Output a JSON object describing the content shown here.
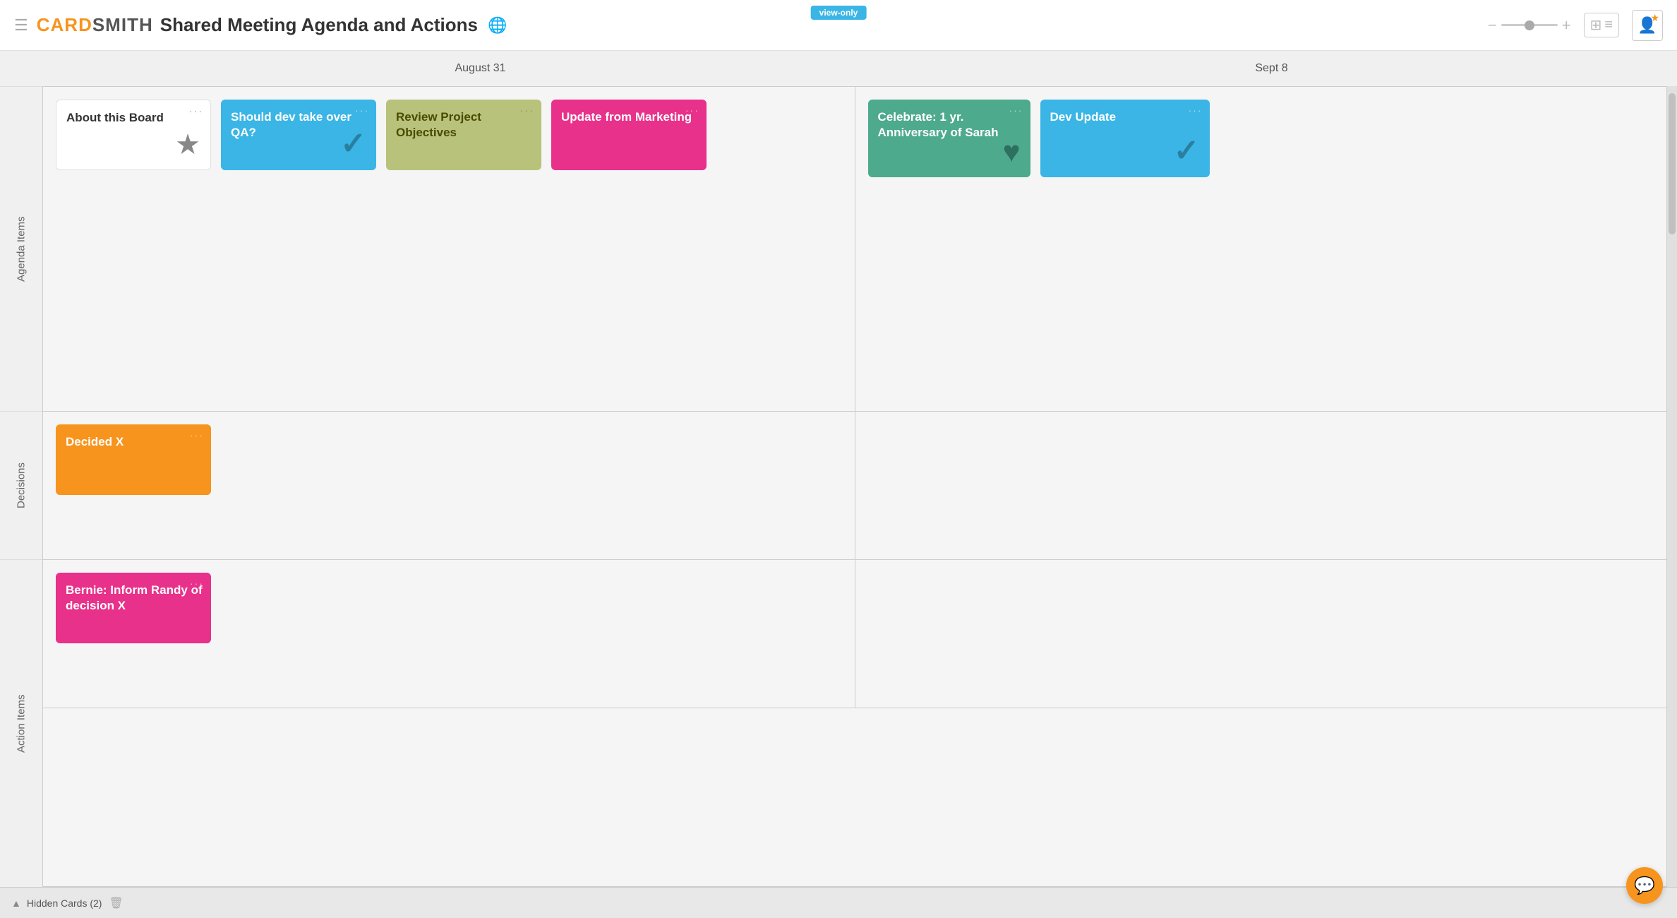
{
  "header": {
    "hamburger": "☰",
    "logo_card": "CARD",
    "logo_smith": "SMITH",
    "board_title": "Shared Meeting Agenda and Actions",
    "view_only_badge": "view-only",
    "zoom_minus": "−",
    "zoom_plus": "+",
    "globe_icon": "🌐",
    "grid_icon": "⊞",
    "list_icon": "≡",
    "profile_icon": "👤",
    "star_icon": "★"
  },
  "columns": [
    {
      "label": "August 31"
    },
    {
      "label": "Sept 8"
    }
  ],
  "rows": [
    {
      "label": "Agenda Items"
    },
    {
      "label": "Decisions"
    },
    {
      "label": "Action Items"
    }
  ],
  "cards": {
    "agenda_aug31": [
      {
        "id": "about-board",
        "title": "About this Board",
        "color": "white",
        "icon": "★",
        "icon_type": "star"
      },
      {
        "id": "should-dev",
        "title": "Should dev take over QA?",
        "color": "blue",
        "icon": "✓",
        "icon_type": "check"
      },
      {
        "id": "review-project",
        "title": "Review Project Objectives",
        "color": "olive",
        "icon": "",
        "icon_type": "none"
      },
      {
        "id": "update-marketing",
        "title": "Update from Marketing",
        "color": "pink",
        "icon": "",
        "icon_type": "none"
      }
    ],
    "agenda_sep8": [
      {
        "id": "celebrate",
        "title": "Celebrate: 1 yr. Anniversary of Sarah",
        "color": "green",
        "icon": "♥",
        "icon_type": "heart"
      },
      {
        "id": "dev-update",
        "title": "Dev Update",
        "color": "blue",
        "icon": "✓",
        "icon_type": "check"
      }
    ],
    "decisions_aug31": [
      {
        "id": "decided-x",
        "title": "Decided X",
        "color": "orange",
        "icon": "",
        "icon_type": "none"
      }
    ],
    "decisions_sep8": [],
    "actions_aug31": [
      {
        "id": "bernie-inform",
        "title": "Bernie: Inform Randy of decision X",
        "color": "hot-pink",
        "icon": "",
        "icon_type": "none"
      }
    ],
    "actions_sep8": []
  },
  "bottom_bar": {
    "hidden_cards_label": "Hidden Cards (2)",
    "chevron": "▲",
    "trash": "🗑"
  },
  "chat": {
    "icon": "💬"
  }
}
